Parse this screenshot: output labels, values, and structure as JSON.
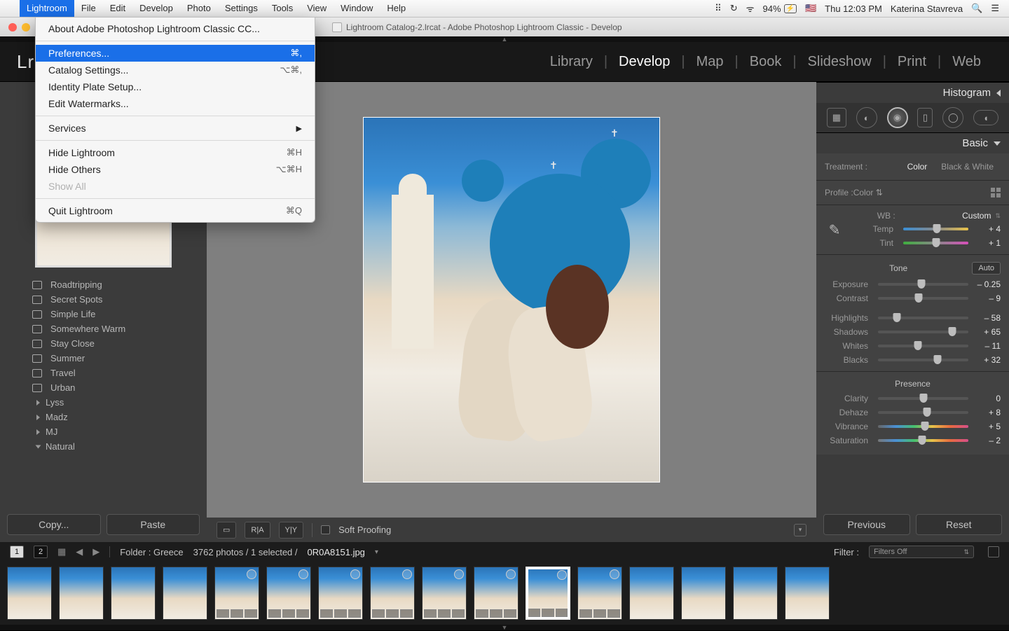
{
  "menubar": {
    "apple": "",
    "appname": "Lightroom",
    "items": [
      "File",
      "Edit",
      "Develop",
      "Photo",
      "Settings",
      "Tools",
      "View",
      "Window",
      "Help"
    ],
    "status": {
      "dropbox": "⠿",
      "timemachine": "↻",
      "wifi": "ᯤ",
      "battery_text": "94%",
      "battery_icon": "⚡",
      "flag": "🇺🇸",
      "clock": "Thu 12:03 PM",
      "user": "Katerina Stavreva",
      "search": "🔍",
      "menu": "☰"
    }
  },
  "dropdown": {
    "about": "About Adobe Photoshop Lightroom Classic CC...",
    "preferences": {
      "label": "Preferences...",
      "shortcut": "⌘,"
    },
    "catalog_settings": {
      "label": "Catalog Settings...",
      "shortcut": "⌥⌘,"
    },
    "identity_plate": "Identity Plate Setup...",
    "edit_watermarks": "Edit Watermarks...",
    "services": "Services",
    "hide_lr": {
      "label": "Hide Lightroom",
      "shortcut": "⌘H"
    },
    "hide_others": {
      "label": "Hide Others",
      "shortcut": "⌥⌘H"
    },
    "show_all": "Show All",
    "quit": {
      "label": "Quit Lightroom",
      "shortcut": "⌘Q"
    }
  },
  "window_title": "Lightroom Catalog-2.lrcat - Adobe Photoshop Lightroom Classic - Develop",
  "logo": "Lr",
  "modules": [
    "Library",
    "Develop",
    "Map",
    "Book",
    "Slideshow",
    "Print",
    "Web"
  ],
  "active_module": "Develop",
  "left": {
    "folders": [
      "Roadtripping",
      "Secret Spots",
      "Simple Life",
      "Somewhere Warm",
      "Stay Close",
      "Summer",
      "Travel",
      "Urban"
    ],
    "groups": [
      {
        "name": "Lyss",
        "open": false
      },
      {
        "name": "Madz",
        "open": false
      },
      {
        "name": "MJ",
        "open": false
      },
      {
        "name": "Natural",
        "open": true
      }
    ],
    "copy": "Copy...",
    "paste": "Paste"
  },
  "toolbar": {
    "view_loupe": "▭",
    "ra": "R|A",
    "yy": "Y|Y",
    "soft_proofing": "Soft Proofing"
  },
  "right": {
    "histogram": "Histogram",
    "basic": "Basic",
    "treatment_label": "Treatment :",
    "treatment_color": "Color",
    "treatment_bw": "Black & White",
    "profile_label": "Profile :",
    "profile_value": "Color",
    "wb_label": "WB :",
    "wb_value": "Custom",
    "temp_label": "Temp",
    "temp_val": "+ 4",
    "tint_label": "Tint",
    "tint_val": "+ 1",
    "tone_label": "Tone",
    "auto": "Auto",
    "exposure_label": "Exposure",
    "exposure_val": "– 0.25",
    "contrast_label": "Contrast",
    "contrast_val": "– 9",
    "highlights_label": "Highlights",
    "highlights_val": "– 58",
    "shadows_label": "Shadows",
    "shadows_val": "+ 65",
    "whites_label": "Whites",
    "whites_val": "– 11",
    "blacks_label": "Blacks",
    "blacks_val": "+ 32",
    "presence_label": "Presence",
    "clarity_label": "Clarity",
    "clarity_val": "0",
    "dehaze_label": "Dehaze",
    "dehaze_val": "+ 8",
    "vibrance_label": "Vibrance",
    "vibrance_val": "+ 5",
    "saturation_label": "Saturation",
    "saturation_val": "– 2",
    "previous": "Previous",
    "reset": "Reset"
  },
  "infobar": {
    "page1": "1",
    "page2": "2",
    "folder_label": "Folder : Greece",
    "count": "3762 photos / 1 selected /",
    "filename": "0R0A8151.jpg",
    "filter_label": "Filter :",
    "filter_value": "Filters Off"
  },
  "filmstrip": {
    "count": 16,
    "selected_index": 10
  }
}
